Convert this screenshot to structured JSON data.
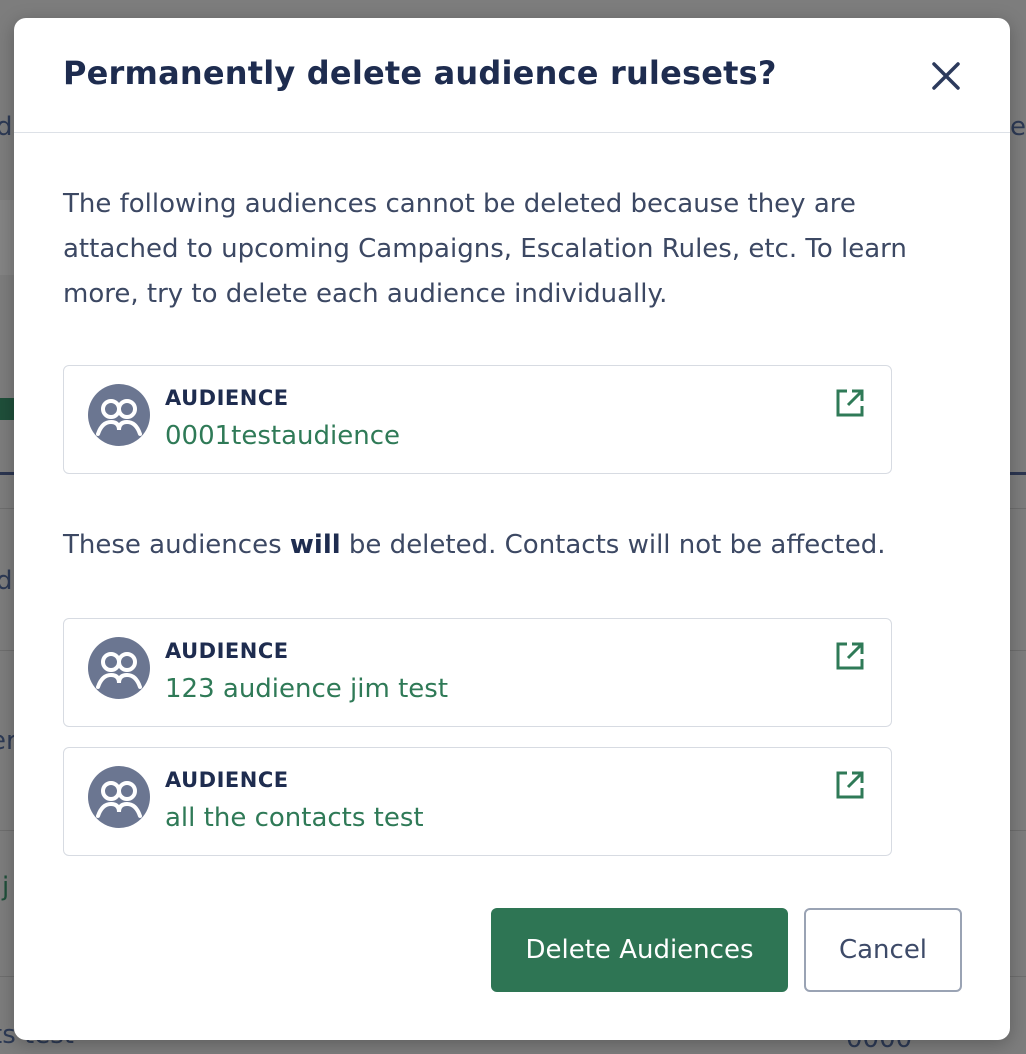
{
  "background": {
    "fragments": [
      "d",
      "e",
      "d",
      "er",
      "j",
      "ts test",
      "0000"
    ]
  },
  "modal": {
    "title": "Permanently delete audience rulesets?",
    "close_icon": "close-icon",
    "intro": "The following audiences cannot be deleted because they are attached to upcoming Campaigns, Escalation Rules, etc. To learn more, try to delete each audience individually.",
    "blocked_audiences": [
      {
        "kicker": "AUDIENCE",
        "name": "0001testaudience",
        "icon": "audience-group-icon",
        "link_icon": "external-link-icon"
      }
    ],
    "will_text": {
      "before": "These audiences ",
      "bold": "will",
      "after": " be deleted. Contacts will not be affected."
    },
    "deletable_audiences": [
      {
        "kicker": "AUDIENCE",
        "name": "123 audience jim test",
        "icon": "audience-group-icon",
        "link_icon": "external-link-icon"
      },
      {
        "kicker": "AUDIENCE",
        "name": "all the contacts test",
        "icon": "audience-group-icon",
        "link_icon": "external-link-icon"
      }
    ],
    "buttons": {
      "delete": "Delete Audiences",
      "cancel": "Cancel"
    }
  },
  "colors": {
    "primary": "#2e7554",
    "title": "#1e2c4f",
    "link_text": "#2f7a57",
    "avatar": "#6b7691"
  }
}
